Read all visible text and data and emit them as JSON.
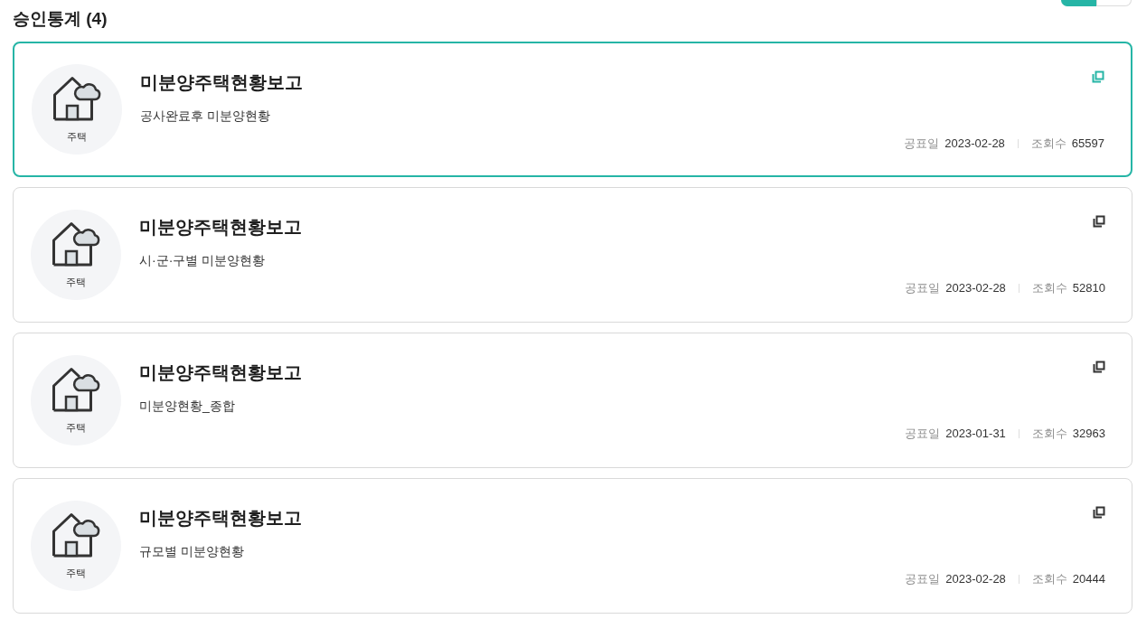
{
  "heading": "승인통계 (4)",
  "view_toggle": [
    {
      "selected": true
    },
    {
      "selected": false
    }
  ],
  "cards": [
    {
      "category": "주택",
      "title": "미분양주택현황보고",
      "subtitle": "공사완료후 미분양현황",
      "date_label": "공표일",
      "date": "2023-02-28",
      "views_label": "조회수",
      "views": "65597",
      "selected": true
    },
    {
      "category": "주택",
      "title": "미분양주택현황보고",
      "subtitle": "시·군·구별 미분양현황",
      "date_label": "공표일",
      "date": "2023-02-28",
      "views_label": "조회수",
      "views": "52810",
      "selected": false
    },
    {
      "category": "주택",
      "title": "미분양주택현황보고",
      "subtitle": "미분양현황_종합",
      "date_label": "공표일",
      "date": "2023-01-31",
      "views_label": "조회수",
      "views": "32963",
      "selected": false
    },
    {
      "category": "주택",
      "title": "미분양주택현황보고",
      "subtitle": "규모별 미분양현황",
      "date_label": "공표일",
      "date": "2023-02-28",
      "views_label": "조회수",
      "views": "20444",
      "selected": false
    }
  ]
}
